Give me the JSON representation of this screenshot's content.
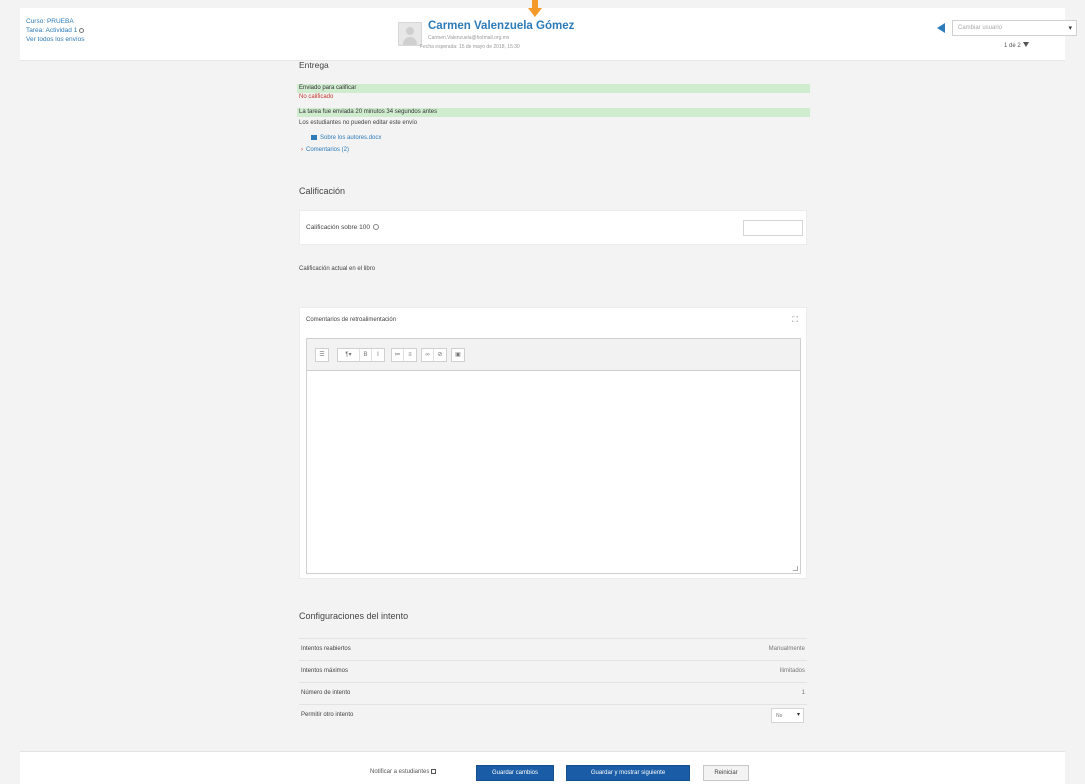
{
  "header": {
    "course_link": "Curso: PRUEBA",
    "task_link": "Tarea: Actividad 1",
    "view_all_link": "Ver todos los envíos",
    "user_name": "Carmen Valenzuela Gómez",
    "user_email": "Carmen.Valenzuela@hotmail.org.mx",
    "due_date": "Fecha esperada: 15 de mayo de 2018, 15:30",
    "change_user_placeholder": "Cambiar usuario",
    "counter": "1 de 2"
  },
  "submission": {
    "heading": "Entrega",
    "status_submitted": "Enviado para calificar",
    "status_not_graded": "No calificado",
    "time_info": "La tarea fue enviada 20 minutos 34 segundos antes",
    "edit_lock": "Los estudiantes no pueden editar este envío",
    "file_link": "Sobre los autores.docx",
    "comments_link": "Comentarios (2)"
  },
  "grading": {
    "heading": "Calificación",
    "grade_label": "Calificación sobre 100",
    "current_grade_label": "Calificación actual en el libro",
    "feedback_label": "Comentarios de retroalimentación"
  },
  "attempt_settings": {
    "heading": "Configuraciones del intento",
    "rows": [
      {
        "label": "Intentos reabiertos",
        "value": "Manualmente"
      },
      {
        "label": "Intentos máximos",
        "value": "Ilimitados"
      },
      {
        "label": "Número de intento",
        "value": "1"
      },
      {
        "label": "Permitir otro intento",
        "value": "No"
      }
    ]
  },
  "footer": {
    "notify_label": "Notificar a estudiantes",
    "save_button": "Guardar cambios",
    "save_next_button": "Guardar y mostrar siguiente",
    "reset_button": "Reiniciar"
  }
}
